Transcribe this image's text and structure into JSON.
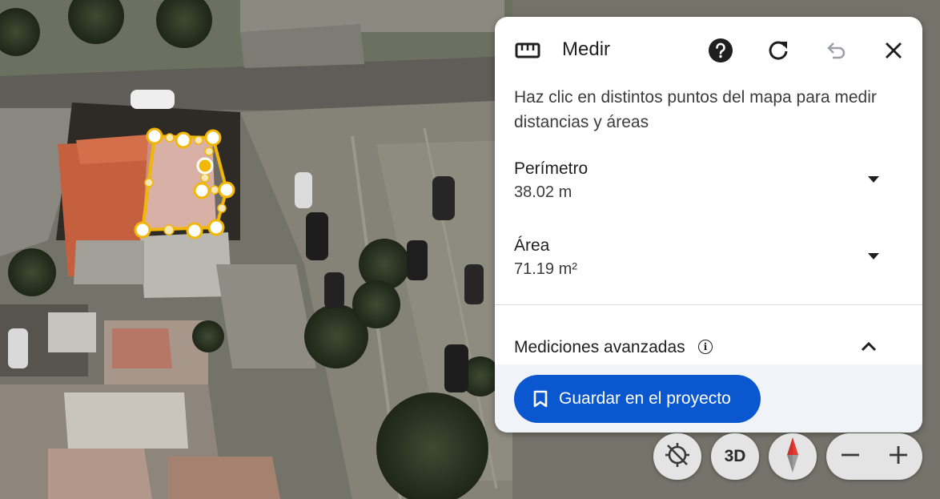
{
  "measure_panel": {
    "title": "Medir",
    "icons": {
      "ruler": "ruler-icon",
      "help": "help-icon",
      "reset": "refresh-icon",
      "undo": "undo-icon",
      "close": "close-icon"
    },
    "instructions": "Haz clic en distintos puntos del mapa para medir distancias y áreas",
    "perimeter": {
      "label": "Perímetro",
      "value": "38.02 m"
    },
    "area": {
      "label": "Área",
      "value": "71.19 m²"
    },
    "advanced": {
      "label": "Mediciones avanzadas",
      "info_icon": "info-icon",
      "expanded": true
    },
    "save_button": {
      "label": "Guardar en el proyecto",
      "icon": "bookmark-icon"
    }
  },
  "map_controls": {
    "recenter_icon": "location-off-icon",
    "view_3d_label": "3D",
    "compass_icon": "compass-icon",
    "zoom_out_icon": "minus-icon",
    "zoom_in_icon": "plus-icon"
  },
  "colors": {
    "accent": "#0b57d0",
    "measure_line": "#f2b705",
    "footer_bg": "#f0f4f9",
    "panel_bg": "#ffffff"
  }
}
